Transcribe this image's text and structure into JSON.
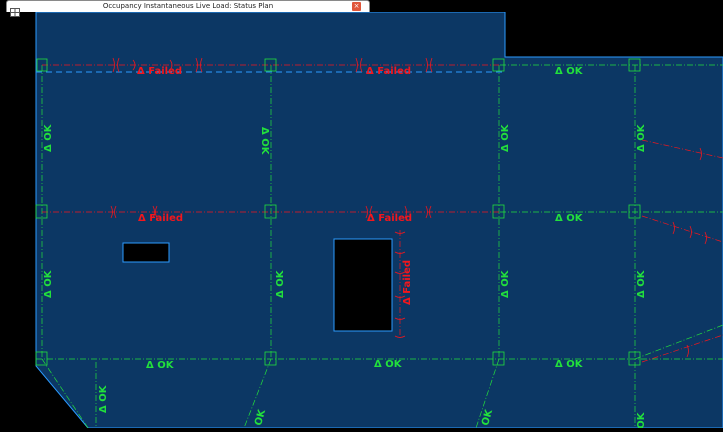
{
  "window": {
    "title": "Occupancy Instantaneous Live Load: Status Plan"
  },
  "tab": {
    "icon": "document-grid-icon",
    "close_icon": "close-icon",
    "close_glyph": "×"
  },
  "colors": {
    "slab": "#0c3764",
    "outline": "#2b9bff",
    "ok": "#22e03c",
    "failed": "#f4161c",
    "background": "#000000"
  },
  "status": {
    "failed": "Δ Failed",
    "ok": "Δ OK"
  }
}
